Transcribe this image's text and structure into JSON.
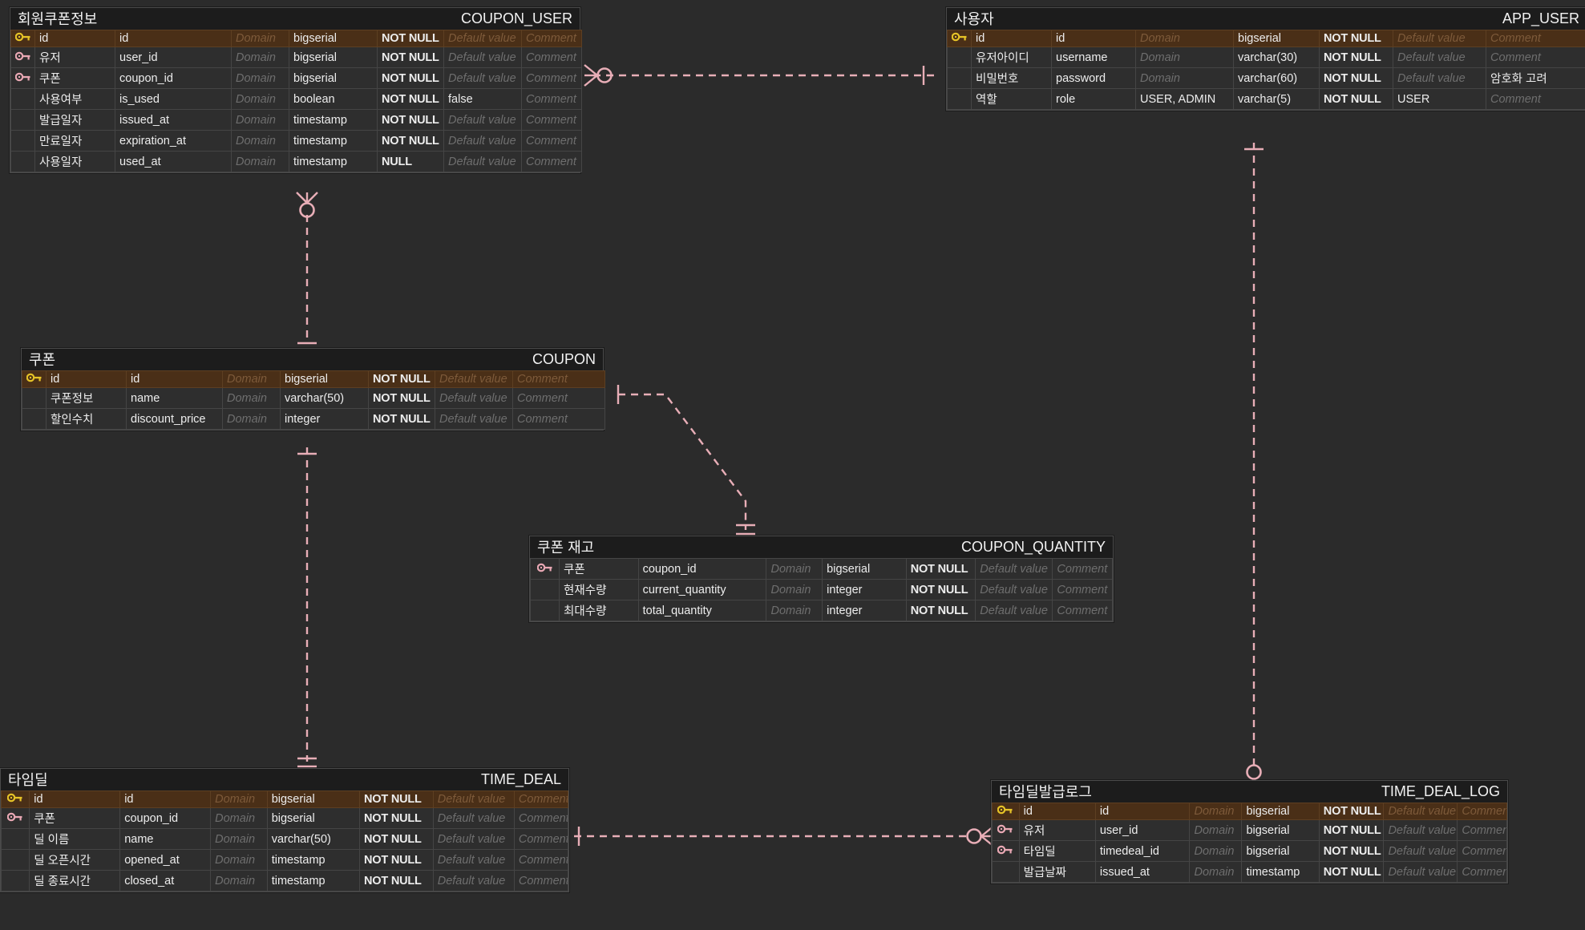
{
  "diagram": {
    "type": "erd",
    "background": "#2b2b2b",
    "entity_bg": "#1e1e1e",
    "pk_row_color": "#4a2f17",
    "relation_color": "#e8aeb7",
    "pk_key_color": "#e6c327",
    "fk_key_color": "#e9a8b4"
  },
  "column_headers": {
    "domain": "Domain",
    "default_value": "Default value",
    "comment": "Comment"
  },
  "entities": [
    {
      "id": "coupon-user",
      "comment": "회원쿠폰정보",
      "name": "COUPON_USER",
      "columns": [
        {
          "key": "pk",
          "logical": "id",
          "physical": "id",
          "domain": "Domain",
          "type": "bigserial",
          "null": "NOT NULL",
          "default": "Default value",
          "comment": "Comment"
        },
        {
          "key": "fk",
          "logical": "유저",
          "physical": "user_id",
          "domain": "Domain",
          "type": "bigserial",
          "null": "NOT NULL",
          "default": "Default value",
          "comment": "Comment"
        },
        {
          "key": "fk",
          "logical": "쿠폰",
          "physical": "coupon_id",
          "domain": "Domain",
          "type": "bigserial",
          "null": "NOT NULL",
          "default": "Default value",
          "comment": "Comment"
        },
        {
          "key": "",
          "logical": "사용여부",
          "physical": "is_used",
          "domain": "Domain",
          "type": "boolean",
          "null": "NOT NULL",
          "default": "false",
          "default_set": true,
          "comment": "Comment"
        },
        {
          "key": "",
          "logical": "발급일자",
          "physical": "issued_at",
          "domain": "Domain",
          "type": "timestamp",
          "null": "NOT NULL",
          "default": "Default value",
          "comment": "Comment"
        },
        {
          "key": "",
          "logical": "만료일자",
          "physical": "expiration_at",
          "domain": "Domain",
          "type": "timestamp",
          "null": "NOT NULL",
          "default": "Default value",
          "comment": "Comment"
        },
        {
          "key": "",
          "logical": "사용일자",
          "physical": "used_at",
          "domain": "Domain",
          "type": "timestamp",
          "null": "NULL",
          "default": "Default value",
          "comment": "Comment"
        }
      ]
    },
    {
      "id": "app-user",
      "comment": "사용자",
      "name": "APP_USER",
      "columns": [
        {
          "key": "pk",
          "logical": "id",
          "physical": "id",
          "domain": "Domain",
          "type": "bigserial",
          "null": "NOT NULL",
          "default": "Default value",
          "comment": "Comment"
        },
        {
          "key": "",
          "logical": "유저아이디",
          "physical": "username",
          "domain": "Domain",
          "type": "varchar(30)",
          "null": "NOT NULL",
          "default": "Default value",
          "comment": "Comment"
        },
        {
          "key": "",
          "logical": "비밀번호",
          "physical": "password",
          "domain": "Domain",
          "type": "varchar(60)",
          "null": "NOT NULL",
          "default": "Default value",
          "comment": "암호화 고려",
          "comment_set": true
        },
        {
          "key": "",
          "logical": "역할",
          "physical": "role",
          "domain": "USER, ADMIN",
          "domain_set": true,
          "type": "varchar(5)",
          "null": "NOT NULL",
          "default": "USER",
          "default_set": true,
          "comment": "Comment"
        }
      ]
    },
    {
      "id": "coupon",
      "comment": "쿠폰",
      "name": "COUPON",
      "columns": [
        {
          "key": "pk",
          "logical": "id",
          "physical": "id",
          "domain": "Domain",
          "type": "bigserial",
          "null": "NOT NULL",
          "default": "Default value",
          "comment": "Comment"
        },
        {
          "key": "",
          "logical": "쿠폰정보",
          "physical": "name",
          "domain": "Domain",
          "type": "varchar(50)",
          "null": "NOT NULL",
          "default": "Default value",
          "comment": "Comment"
        },
        {
          "key": "",
          "logical": "할인수치",
          "physical": "discount_price",
          "domain": "Domain",
          "type": "integer",
          "null": "NOT NULL",
          "default": "Default value",
          "comment": "Comment"
        }
      ]
    },
    {
      "id": "coupon-quantity",
      "comment": "쿠폰 재고",
      "name": "COUPON_QUANTITY",
      "columns": [
        {
          "key": "fk",
          "logical": "쿠폰",
          "physical": "coupon_id",
          "domain": "Domain",
          "type": "bigserial",
          "null": "NOT NULL",
          "default": "Default value",
          "comment": "Comment"
        },
        {
          "key": "",
          "logical": "현재수량",
          "physical": "current_quantity",
          "domain": "Domain",
          "type": "integer",
          "null": "NOT NULL",
          "default": "Default value",
          "comment": "Comment"
        },
        {
          "key": "",
          "logical": "최대수량",
          "physical": "total_quantity",
          "domain": "Domain",
          "type": "integer",
          "null": "NOT NULL",
          "default": "Default value",
          "comment": "Comment"
        }
      ]
    },
    {
      "id": "time-deal",
      "comment": "타임딜",
      "name": "TIME_DEAL",
      "columns": [
        {
          "key": "pk",
          "logical": "id",
          "physical": "id",
          "domain": "Domain",
          "type": "bigserial",
          "null": "NOT NULL",
          "default": "Default value",
          "comment": "Comment"
        },
        {
          "key": "fk",
          "logical": "쿠폰",
          "physical": "coupon_id",
          "domain": "Domain",
          "type": "bigserial",
          "null": "NOT NULL",
          "default": "Default value",
          "comment": "Comment"
        },
        {
          "key": "",
          "logical": "딜 이름",
          "physical": "name",
          "domain": "Domain",
          "type": "varchar(50)",
          "null": "NOT NULL",
          "default": "Default value",
          "comment": "Comment"
        },
        {
          "key": "",
          "logical": "딜 오픈시간",
          "physical": "opened_at",
          "domain": "Domain",
          "type": "timestamp",
          "null": "NOT NULL",
          "default": "Default value",
          "comment": "Comment"
        },
        {
          "key": "",
          "logical": "딜 종료시간",
          "physical": "closed_at",
          "domain": "Domain",
          "type": "timestamp",
          "null": "NOT NULL",
          "default": "Default value",
          "comment": "Comment"
        }
      ]
    },
    {
      "id": "time-deal-log",
      "comment": "타임딜발급로그",
      "name": "TIME_DEAL_LOG",
      "columns": [
        {
          "key": "pk",
          "logical": "id",
          "physical": "id",
          "domain": "Domain",
          "type": "bigserial",
          "null": "NOT NULL",
          "default": "Default value",
          "comment": "Comment"
        },
        {
          "key": "fk",
          "logical": "유저",
          "physical": "user_id",
          "domain": "Domain",
          "type": "bigserial",
          "null": "NOT NULL",
          "default": "Default value",
          "comment": "Comment"
        },
        {
          "key": "fk",
          "logical": "타임딜",
          "physical": "timedeal_id",
          "domain": "Domain",
          "type": "bigserial",
          "null": "NOT NULL",
          "default": "Default value",
          "comment": "Comment"
        },
        {
          "key": "",
          "logical": "발급날짜",
          "physical": "issued_at",
          "domain": "Domain",
          "type": "timestamp",
          "null": "NOT NULL",
          "default": "Default value",
          "comment": "Comment"
        }
      ]
    }
  ],
  "relationships": [
    {
      "id": "rel-appuser-couponuser",
      "from": "APP_USER",
      "to": "COUPON_USER",
      "from_cardinality": "one",
      "to_cardinality": "zero-or-many"
    },
    {
      "id": "rel-coupon-couponuser",
      "from": "COUPON",
      "to": "COUPON_USER",
      "from_cardinality": "one",
      "to_cardinality": "zero-or-many"
    },
    {
      "id": "rel-coupon-quantity",
      "from": "COUPON",
      "to": "COUPON_QUANTITY",
      "from_cardinality": "one",
      "to_cardinality": "one-and-only-one"
    },
    {
      "id": "rel-coupon-timedeal",
      "from": "COUPON",
      "to": "TIME_DEAL",
      "from_cardinality": "one",
      "to_cardinality": "one-and-only-one"
    },
    {
      "id": "rel-timedeal-log",
      "from": "TIME_DEAL",
      "to": "TIME_DEAL_LOG",
      "from_cardinality": "one",
      "to_cardinality": "zero-or-many"
    },
    {
      "id": "rel-appuser-timedeallog",
      "from": "APP_USER",
      "to": "TIME_DEAL_LOG",
      "from_cardinality": "one",
      "to_cardinality": "zero-or-many"
    }
  ]
}
